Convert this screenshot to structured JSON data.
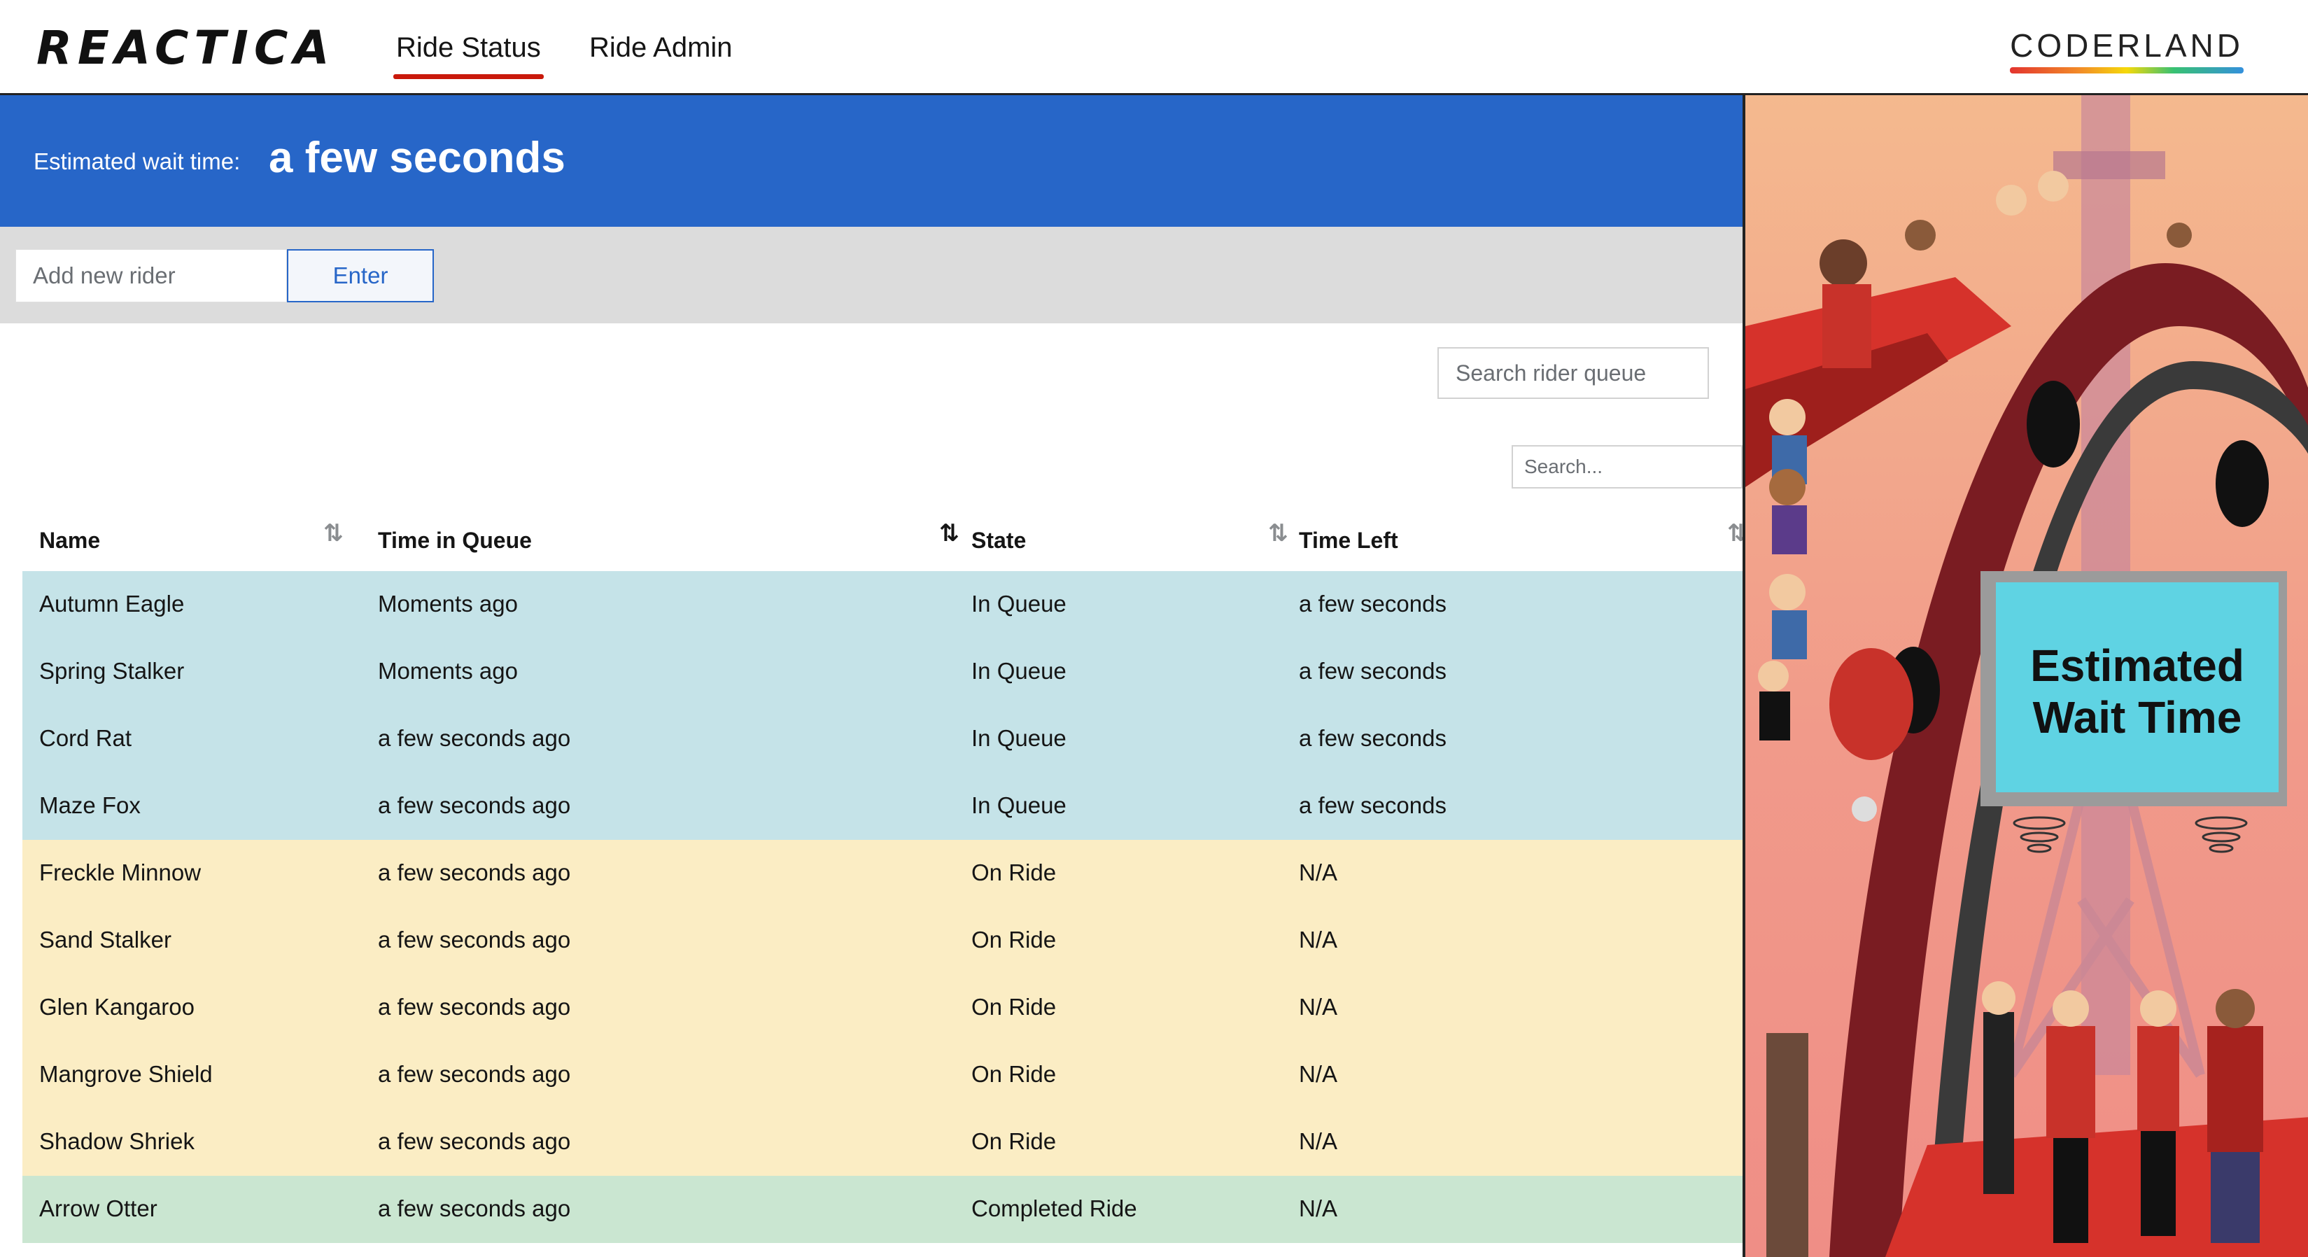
{
  "header": {
    "logo": "REACTICA",
    "tabs": [
      {
        "label": "Ride Status",
        "active": true
      },
      {
        "label": "Ride Admin",
        "active": false
      }
    ],
    "brand": "CODERLAND"
  },
  "banner": {
    "label": "Estimated wait time:",
    "value": "a few seconds",
    "color": "#2766c8"
  },
  "entry": {
    "placeholder": "Add new rider",
    "button": "Enter"
  },
  "search": {
    "queue_placeholder": "Search rider queue",
    "table_placeholder": "Search..."
  },
  "table": {
    "columns": [
      "Name",
      "Time in Queue",
      "State",
      "Time Left"
    ],
    "sort_column": "Time in Queue",
    "state_colors": {
      "In Queue": "#c5e3e8",
      "On Ride": "#fbedc4",
      "Completed Ride": "#cae6d1"
    },
    "rows": [
      {
        "name": "Autumn Eagle",
        "time": "Moments ago",
        "state": "In Queue",
        "left": "a few seconds"
      },
      {
        "name": "Spring Stalker",
        "time": "Moments ago",
        "state": "In Queue",
        "left": "a few seconds"
      },
      {
        "name": "Cord Rat",
        "time": "a few seconds ago",
        "state": "In Queue",
        "left": "a few seconds"
      },
      {
        "name": "Maze Fox",
        "time": "a few seconds ago",
        "state": "In Queue",
        "left": "a few seconds"
      },
      {
        "name": "Freckle Minnow",
        "time": "a few seconds ago",
        "state": "On Ride",
        "left": "N/A"
      },
      {
        "name": "Sand Stalker",
        "time": "a few seconds ago",
        "state": "On Ride",
        "left": "N/A"
      },
      {
        "name": "Glen Kangaroo",
        "time": "a few seconds ago",
        "state": "On Ride",
        "left": "N/A"
      },
      {
        "name": "Mangrove Shield",
        "time": "a few seconds ago",
        "state": "On Ride",
        "left": "N/A"
      },
      {
        "name": "Shadow Shriek",
        "time": "a few seconds ago",
        "state": "On Ride",
        "left": "N/A"
      },
      {
        "name": "Arrow Otter",
        "time": "a few seconds ago",
        "state": "Completed Ride",
        "left": "N/A"
      }
    ]
  },
  "illustration": {
    "sign_line1": "Estimated",
    "sign_line2": "Wait Time"
  }
}
